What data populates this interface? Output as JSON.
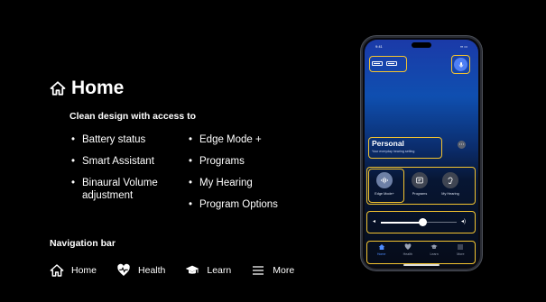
{
  "slide": {
    "title": "Home",
    "subtitle": "Clean design with access to",
    "features_left": [
      "Battery status",
      "Smart Assistant",
      "Binaural Volume adjustment"
    ],
    "features_right": [
      "Edge Mode +",
      "Programs",
      "My Hearing",
      "Program Options"
    ],
    "nav_heading": "Navigation bar",
    "nav_items": [
      {
        "label": "Home",
        "icon": "home-icon"
      },
      {
        "label": "Health",
        "icon": "heart-icon"
      },
      {
        "label": "Learn",
        "icon": "graduation-cap-icon"
      },
      {
        "label": "More",
        "icon": "menu-icon"
      }
    ]
  },
  "phone": {
    "status_time": "9:41",
    "program": {
      "name": "Personal",
      "description": "Your everyday hearing setting"
    },
    "controls": [
      {
        "label": "Edge Mode+",
        "icon": "soundwave-icon"
      },
      {
        "label": "Programs",
        "icon": "programs-icon"
      },
      {
        "label": "My Hearing",
        "icon": "ear-icon"
      }
    ],
    "volume_level": 0.55,
    "tabs": [
      {
        "label": "Home",
        "icon": "home-icon",
        "active": true
      },
      {
        "label": "Health",
        "icon": "heart-icon",
        "active": false
      },
      {
        "label": "Learn",
        "icon": "graduation-cap-icon",
        "active": false
      },
      {
        "label": "More",
        "icon": "menu-icon",
        "active": false
      }
    ]
  },
  "colors": {
    "background": "#000000",
    "highlight": "#f4c430",
    "accent": "#4e8cff"
  }
}
